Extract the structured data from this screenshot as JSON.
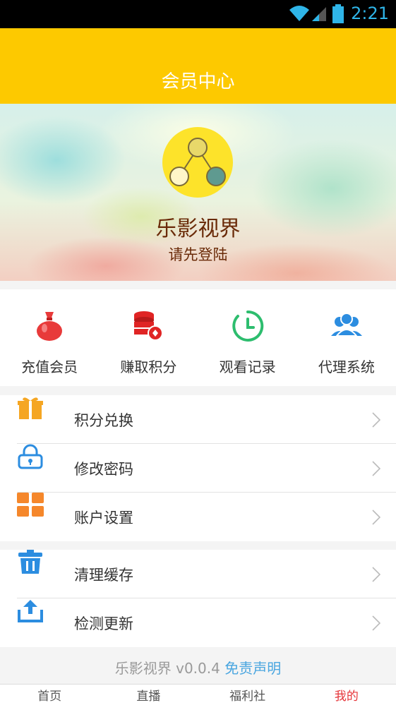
{
  "status_bar": {
    "time": "2:21"
  },
  "header": {
    "title": "会员中心"
  },
  "profile": {
    "app_name": "乐影视界",
    "login_prompt": "请先登陆"
  },
  "quick_actions": [
    {
      "label": "充值会员",
      "icon": "money-bag-icon",
      "color": "#e83a3a"
    },
    {
      "label": "赚取积分",
      "icon": "coin-stack-icon",
      "color": "#e02424"
    },
    {
      "label": "观看记录",
      "icon": "clock-icon",
      "color": "#2dbd6e"
    },
    {
      "label": "代理系统",
      "icon": "users-icon",
      "color": "#2c8de0"
    }
  ],
  "menu_group1": [
    {
      "label": "积分兑换",
      "icon": "gift-icon",
      "color": "#f5a623"
    },
    {
      "label": "修改密码",
      "icon": "lock-icon",
      "color": "#2c8de0"
    },
    {
      "label": "账户设置",
      "icon": "grid-icon",
      "color": "#f5872b"
    }
  ],
  "menu_group2": [
    {
      "label": "清理缓存",
      "icon": "trash-icon",
      "color": "#2c8de0"
    },
    {
      "label": "检测更新",
      "icon": "upload-icon",
      "color": "#2c8de0"
    }
  ],
  "footer": {
    "version_text": "乐影视界 v0.0.4",
    "disclaimer_link": "免责声明"
  },
  "tabbar": [
    {
      "label": "首页",
      "active": false
    },
    {
      "label": "直播",
      "active": false
    },
    {
      "label": "福利社",
      "active": false
    },
    {
      "label": "我的",
      "active": true
    }
  ]
}
